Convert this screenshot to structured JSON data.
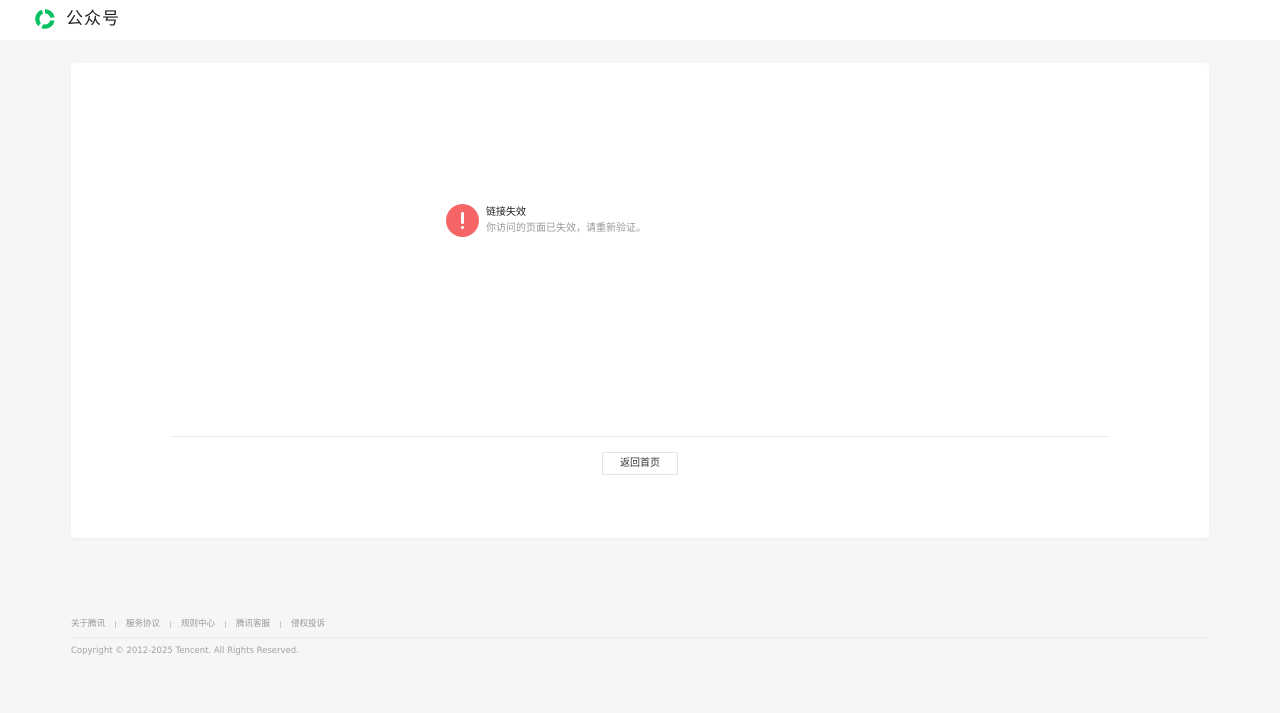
{
  "header": {
    "brand_name": "公众号",
    "logo_icon": "wechat-official-account-logo",
    "logo_color": "#07c160"
  },
  "message": {
    "icon": "exclamation-circle-icon",
    "icon_color": "#f56565",
    "title": "链接失效",
    "description": "你访问的页面已失效，请重新验证。"
  },
  "actions": {
    "back_home_label": "返回首页"
  },
  "footer": {
    "links": [
      "关于腾讯",
      "服务协议",
      "规则中心",
      "腾讯客服",
      "侵权投诉"
    ],
    "copyright": "Copyright © 2012-2025 Tencent. All Rights Reserved."
  }
}
